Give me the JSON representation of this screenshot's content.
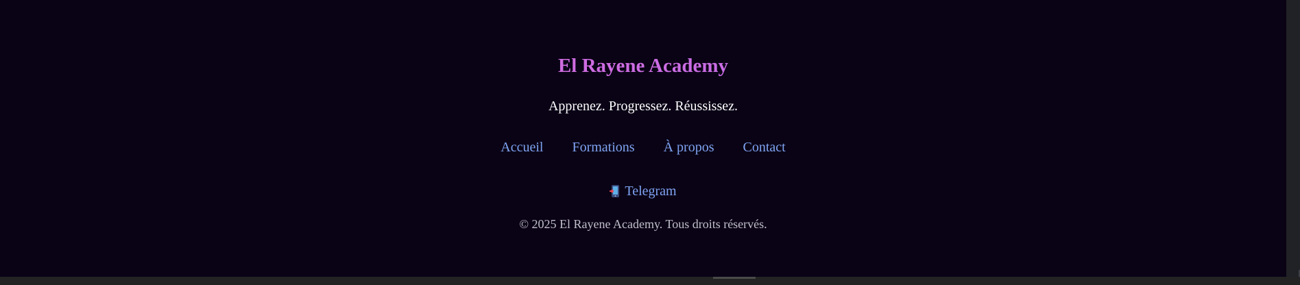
{
  "footer": {
    "brand_title": "El Rayene Academy",
    "tagline": "Apprenez. Progressez. Réussissez.",
    "nav": [
      {
        "label": "Accueil"
      },
      {
        "label": "Formations"
      },
      {
        "label": "À propos"
      },
      {
        "label": "Contact"
      }
    ],
    "social": {
      "icon": "mobile-phone-icon",
      "label": "Telegram"
    },
    "copyright": "© 2025 El Rayene Academy. Tous droits réservés."
  },
  "colors": {
    "background": "#0a0316",
    "brand_gradient_start": "#e86ad2",
    "brand_gradient_end": "#a98bef",
    "link": "#7fa4f2",
    "tagline": "#ffffff",
    "copyright": "#c2bfcc"
  }
}
